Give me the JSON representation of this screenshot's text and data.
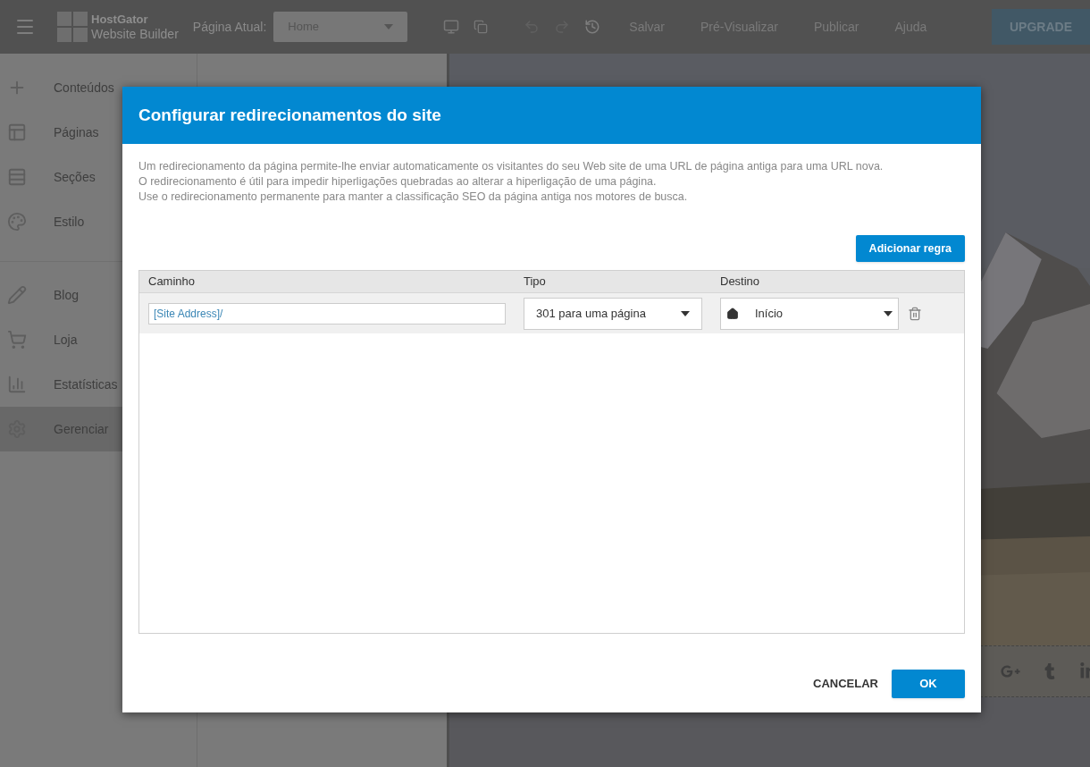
{
  "topbar": {
    "logo": {
      "name": "HostGator",
      "subtitle": "Website Builder"
    },
    "page_label": "Página Atual:",
    "page_select": {
      "value": "Home"
    },
    "history": [
      {
        "kind": "undo",
        "disabled": true
      },
      {
        "kind": "redo",
        "disabled": true
      },
      {
        "kind": "history",
        "disabled": false
      }
    ],
    "actions": [
      "Salvar",
      "Pré-Visualizar",
      "Publicar",
      "Ajuda"
    ],
    "upgrade": "UPGRADE"
  },
  "sidebar": {
    "groups": [
      [
        {
          "kind": "add",
          "label": "Conteúdos",
          "selected": false
        },
        {
          "kind": "pages",
          "label": "Páginas",
          "selected": false
        },
        {
          "kind": "sections",
          "label": "Seções",
          "selected": false
        },
        {
          "kind": "style",
          "label": "Estilo",
          "selected": false
        }
      ],
      [
        {
          "kind": "blog",
          "label": "Blog",
          "selected": false
        },
        {
          "kind": "store",
          "label": "Loja",
          "selected": false
        },
        {
          "kind": "stats",
          "label": "Estatísticas",
          "selected": false
        },
        {
          "kind": "manage",
          "label": "Gerenciar",
          "selected": true
        }
      ]
    ]
  },
  "dialog": {
    "title": "Configurar redirecionamentos do site",
    "description": [
      "Um redirecionamento da página permite-lhe enviar automaticamente os visitantes do seu Web site de uma URL de página antiga para uma URL nova.",
      "O redirecionamento é útil para impedir hiperligações quebradas ao alterar a hiperligação de uma página.",
      "Use o redirecionamento permanente para manter a classificação SEO da página antiga nos motores de busca."
    ],
    "add_rule": "Adicionar regra",
    "table": {
      "columns": [
        "Caminho",
        "Tipo",
        "Destino"
      ],
      "rows": [
        {
          "path": "[Site Address]/",
          "type": "301 para uma página",
          "destination": "Início"
        }
      ]
    },
    "cancel": "CANCELAR",
    "ok": "OK"
  }
}
